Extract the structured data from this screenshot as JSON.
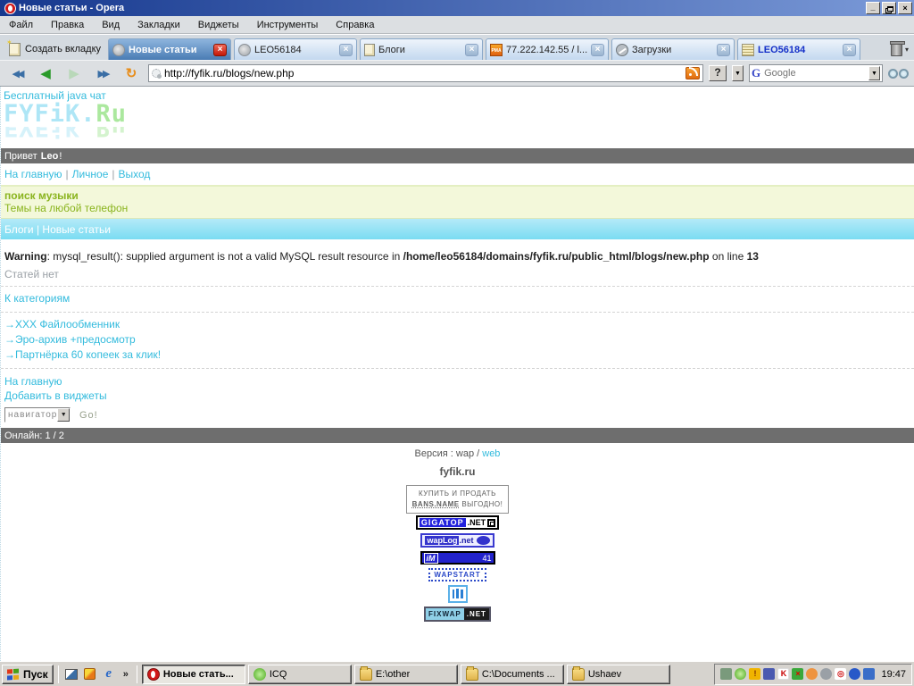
{
  "window": {
    "title": "Новые статьи - Opera"
  },
  "menu": {
    "items": [
      "Файл",
      "Правка",
      "Вид",
      "Закладки",
      "Виджеты",
      "Инструменты",
      "Справка"
    ]
  },
  "tabbar": {
    "new_tab": "Создать вкладку",
    "tabs": [
      {
        "label": "Новые статьи"
      },
      {
        "label": "LEO56184"
      },
      {
        "label": "Блоги"
      },
      {
        "label": "77.222.142.55 / l..."
      },
      {
        "label": "Загрузки"
      },
      {
        "label": "LEO56184"
      }
    ]
  },
  "toolbar": {
    "address": "http://fyfik.ru/blogs/new.php",
    "search_placeholder": "Google"
  },
  "icons": {
    "close": "×",
    "minimize": "_",
    "dropdown": "▼",
    "small_arrow": "▾",
    "rewind": "◀◀",
    "back": "◀",
    "forward": "▶",
    "fastforward": "▶▶",
    "reload": "↻",
    "help": "?",
    "google_g": "G",
    "ie_e": "e",
    "overflow": "»",
    "kaspersky_k": "K",
    "alert": "!",
    "error_x": "×",
    "target": "◎"
  },
  "page": {
    "chat_link": "Бесплатный java чат",
    "logo": {
      "part1": "FYFiK.",
      "part2": "Ru"
    },
    "greeting": {
      "prefix": "Привет",
      "name": "Leo",
      "suffix": "!"
    },
    "nav": {
      "links": [
        "На главную",
        "Личное",
        "Выход"
      ],
      "sep": "|"
    },
    "promo": {
      "title": "поиск музыки",
      "link": "Темы на любой телефон"
    },
    "breadcrumb": "Блоги | Новые статьи",
    "warning": {
      "label": "Warning",
      "text1": ": mysql_result(): supplied argument is not a valid MySQL result resource in ",
      "path": "/home/leo56184/domains/fyfik.ru/public_html/blogs/new.php",
      "text2": " on line ",
      "line": "13"
    },
    "empty_msg": "Статей нет",
    "categories_link": "К категориям",
    "category_links": [
      "→XXX Файлообменник",
      "→Эро-архив +предосмотр",
      "→Партнёрка 60 копеек за клик!"
    ],
    "home_link": "На главную",
    "widgets_link": "Добавить в виджеты",
    "navigator": {
      "value": "навигатор",
      "go": "Go!"
    },
    "online": "Онлайн: 1 / 2",
    "version": {
      "prefix": "Версия : wap / ",
      "link": "web"
    },
    "site_name": "fyfik.ru",
    "banners": {
      "bansname": {
        "line1": "КУПИТЬ И ПРОДАТЬ",
        "line2_u": "BANS.NAME",
        "line2": " ВЫГОДНО!"
      },
      "gigatop": {
        "name": "GIGATOP",
        "tld": ".NET"
      },
      "waplog": {
        "name": "wapLog",
        "tld": ".net"
      },
      "im": {
        "label": "iM",
        "value": "41"
      },
      "wapstart": "WAPSTART",
      "fixwap": {
        "name": "FIXWAP",
        "tld": ".NET"
      }
    }
  },
  "taskbar": {
    "start": "Пуск",
    "tasks": [
      {
        "label": "Новые стать..."
      },
      {
        "label": "ICQ"
      },
      {
        "label": "E:\\other"
      },
      {
        "label": "C:\\Documents ..."
      },
      {
        "label": "Ushaev"
      }
    ],
    "clock": "19:47"
  },
  "colors": {
    "accent_link": "#33bbdd",
    "promo_green": "#8ab41e",
    "band_gray": "#6e6e6e",
    "crumb_cyan": "#7adcf2"
  }
}
